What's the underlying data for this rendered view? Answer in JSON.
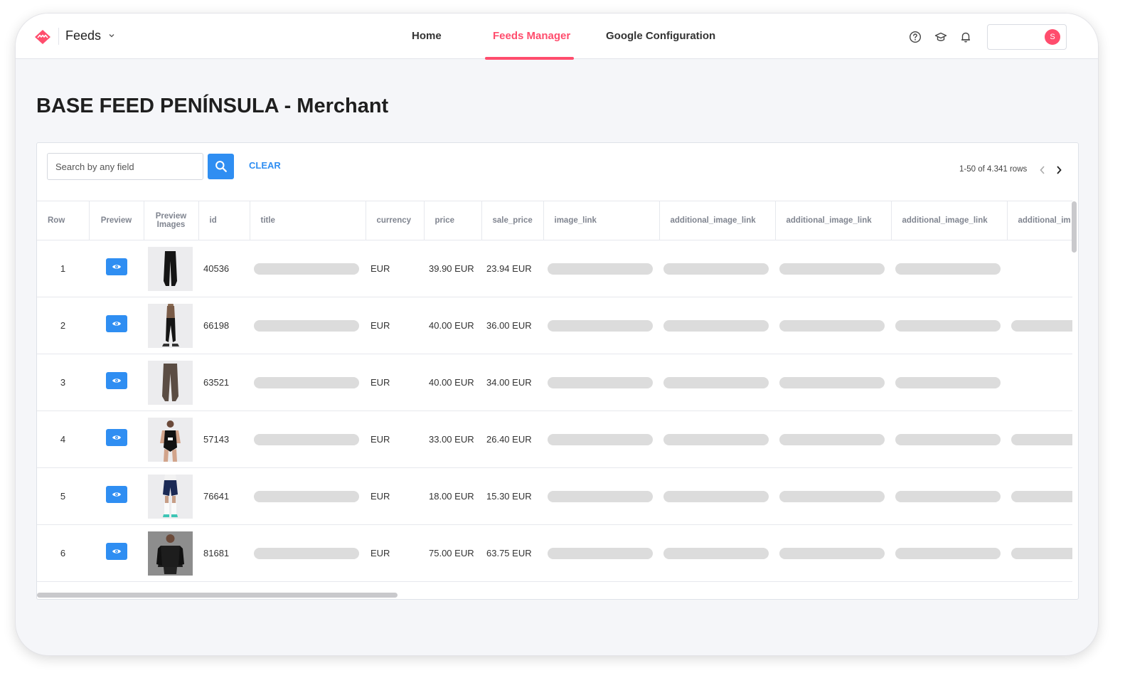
{
  "header": {
    "app_name": "Feeds",
    "nav": [
      {
        "label": "Home"
      },
      {
        "label": "Feeds Manager",
        "active": true
      },
      {
        "label": "Google Configuration"
      }
    ],
    "user_initial": "S",
    "accent_color": "#ff4d6d",
    "icons": [
      "help-icon",
      "graduation-cap-icon",
      "bell-icon"
    ]
  },
  "page": {
    "title": "BASE FEED PENÍNSULA - Merchant"
  },
  "toolbar": {
    "search_placeholder": "Search by any field",
    "search_value": "",
    "clear_label": "CLEAR",
    "pagination": "1-50 of 4.341 rows"
  },
  "table": {
    "columns": [
      "Row",
      "Preview",
      "Preview Images",
      "id",
      "title",
      "currency",
      "price",
      "sale_price",
      "image_link",
      "additional_image_link",
      "additional_image_link",
      "additional_image_link",
      "additional_im"
    ],
    "rows": [
      {
        "row": "1",
        "id": "40536",
        "currency": "EUR",
        "price": "39.90 EUR",
        "sale_price": "23.94 EUR",
        "image": "black-pants",
        "extra_link": false
      },
      {
        "row": "2",
        "id": "66198",
        "currency": "EUR",
        "price": "40.00 EUR",
        "sale_price": "36.00 EUR",
        "image": "model-black-pants",
        "extra_link": true
      },
      {
        "row": "3",
        "id": "63521",
        "currency": "EUR",
        "price": "40.00 EUR",
        "sale_price": "34.00 EUR",
        "image": "brown-pants",
        "extra_link": false
      },
      {
        "row": "4",
        "id": "57143",
        "currency": "EUR",
        "price": "33.00 EUR",
        "sale_price": "26.40 EUR",
        "image": "swimsuit",
        "extra_link": true
      },
      {
        "row": "5",
        "id": "76641",
        "currency": "EUR",
        "price": "18.00 EUR",
        "sale_price": "15.30 EUR",
        "image": "shorts",
        "extra_link": true
      },
      {
        "row": "6",
        "id": "81681",
        "currency": "EUR",
        "price": "75.00 EUR",
        "sale_price": "63.75 EUR",
        "image": "jacket",
        "extra_link": true
      }
    ]
  }
}
